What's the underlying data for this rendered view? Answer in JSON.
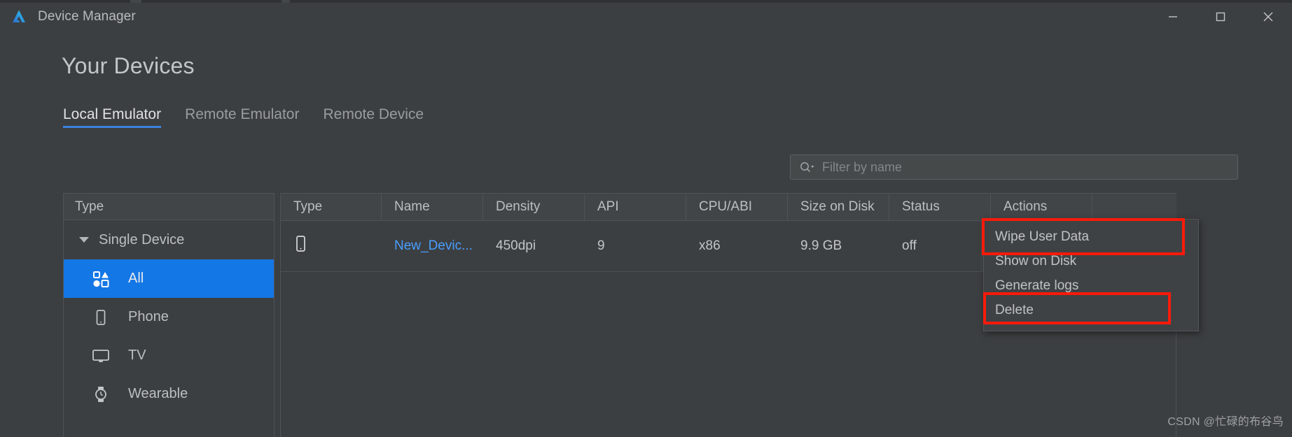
{
  "window": {
    "title": "Device Manager",
    "logo_icon": "android-studio-logo",
    "controls": {
      "minimize": "minimize-icon",
      "maximize": "maximize-icon",
      "close": "close-icon"
    }
  },
  "page": {
    "heading": "Your Devices"
  },
  "tabs": [
    {
      "label": "Local Emulator",
      "active": true
    },
    {
      "label": "Remote Emulator",
      "active": false
    },
    {
      "label": "Remote Device",
      "active": false
    }
  ],
  "filter": {
    "placeholder": "Filter by name",
    "value": "",
    "icon": "search-icon",
    "dropdown_icon": "chevron-down-icon"
  },
  "sidebar": {
    "header": "Type",
    "group": {
      "label": "Single Device",
      "expanded": true
    },
    "items": [
      {
        "label": "All",
        "icon": "all-devices-icon",
        "selected": true
      },
      {
        "label": "Phone",
        "icon": "phone-icon",
        "selected": false
      },
      {
        "label": "TV",
        "icon": "tv-icon",
        "selected": false
      },
      {
        "label": "Wearable",
        "icon": "watch-icon",
        "selected": false
      }
    ]
  },
  "table": {
    "columns": [
      "Type",
      "Name",
      "Density",
      "API",
      "CPU/ABI",
      "Size on Disk",
      "Status",
      "Actions"
    ],
    "rows": [
      {
        "type_icon": "phone-icon",
        "name": "New_Devic...",
        "density": "450dpi",
        "api": "9",
        "cpu_abi": "x86",
        "size_on_disk": "9.9 GB",
        "status": "off",
        "action_icon": "play-icon"
      }
    ]
  },
  "context_menu": {
    "items": [
      {
        "label": "Wipe User Data",
        "highlighted": true
      },
      {
        "label": "Show on Disk",
        "highlighted": false
      },
      {
        "label": "Generate logs",
        "highlighted": false
      },
      {
        "label": "Delete",
        "highlighted": true
      }
    ]
  },
  "watermark": "CSDN @忙碌的布谷鸟",
  "colors": {
    "background": "#3c3f41",
    "accent_selected": "#1477e6",
    "tab_underline": "#3b82e0",
    "link": "#4a9eff",
    "play_green": "#20a59a",
    "highlight_red": "#f91a0b"
  }
}
